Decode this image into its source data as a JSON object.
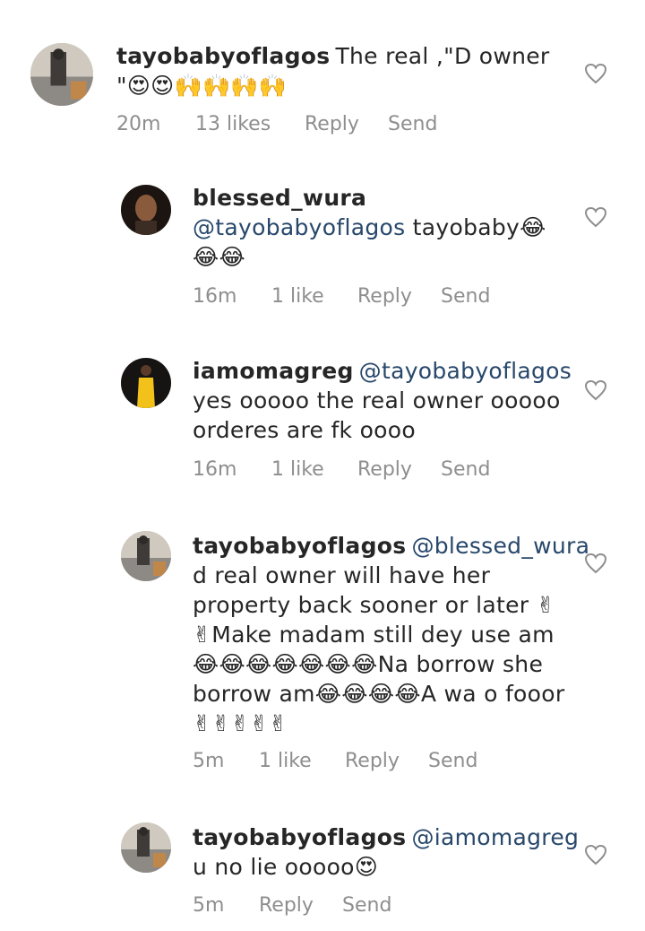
{
  "comments": [
    {
      "username": "tayobabyoflagos",
      "mention": "",
      "text": "The real ,\"D owner \"😍😍🙌🙌🙌🙌",
      "time": "20m",
      "likes": "13 likes",
      "reply": "Reply",
      "send": "Send",
      "avatar_color": "#b9b4ab"
    },
    {
      "username": "blessed_wura",
      "mention": "@tayobabyoflagos",
      "text": "tayobaby😂😂😂",
      "time": "16m",
      "likes": "1 like",
      "reply": "Reply",
      "send": "Send",
      "avatar_color": "#3a2a22"
    },
    {
      "username": "iamomagreg",
      "mention": "@tayobabyoflagos",
      "text": "yes ooooo the real owner ooooo orderes are fk oooo",
      "time": "16m",
      "likes": "1 like",
      "reply": "Reply",
      "send": "Send",
      "avatar_color": "#1d1a17"
    },
    {
      "username": "tayobabyoflagos",
      "mention": "@blessed_wura",
      "text": "d real owner will have her property back sooner or later ✌✌Make madam still dey use am 😂😂😂😂😂😂😂Na borrow she borrow am😂😂😂😂A wa o fooor ✌✌✌✌✌",
      "time": "5m",
      "likes": "1 like",
      "reply": "Reply",
      "send": "Send",
      "avatar_color": "#b9b4ab"
    },
    {
      "username": "tayobabyoflagos",
      "mention": "@iamomagreg",
      "text": "u no lie ooooo😍",
      "time": "5m",
      "likes": "",
      "reply": "Reply",
      "send": "Send",
      "avatar_color": "#b9b4ab"
    }
  ],
  "icons": {
    "like": "heart-outline-icon"
  },
  "colors": {
    "mention": "#27476b",
    "meta": "#8e8e8e",
    "text": "#262626"
  }
}
